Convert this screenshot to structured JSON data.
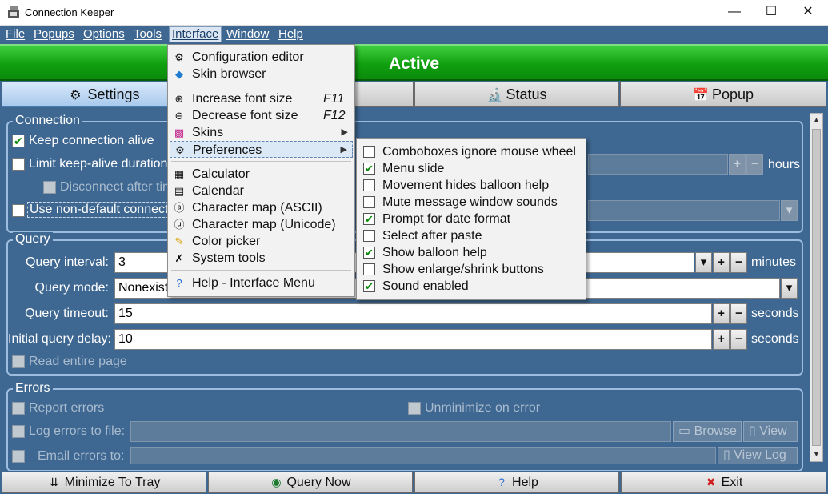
{
  "window": {
    "title": "Connection Keeper",
    "minimize": "—",
    "maximize": "☐",
    "close": "✕"
  },
  "menubar": [
    "File",
    "Popups",
    "Options",
    "Tools",
    "Interface",
    "Window",
    "Help"
  ],
  "status": {
    "text": "Active",
    "color": "#12a512"
  },
  "tabs": {
    "settings": {
      "label": "Settings",
      "icon": "gear-icon"
    },
    "status": {
      "label": "Status",
      "icon": "microscope-icon"
    },
    "popup": {
      "label": "Popup",
      "icon": "calendar-icon"
    }
  },
  "connection": {
    "label": "Connection",
    "keep_alive": {
      "label": "Keep connection alive",
      "checked": true
    },
    "limit_duration": {
      "label": "Limit keep-alive duration",
      "checked": false
    },
    "disconnect_after": {
      "label": "Disconnect after tim",
      "checked": false
    },
    "non_default": {
      "label": "Use non-default connectio",
      "checked": false
    },
    "hours_unit": "hours"
  },
  "query": {
    "label": "Query",
    "interval_label": "Query interval:",
    "interval_value": "3",
    "interval_unit": "minutes",
    "mode_label": "Query mode:",
    "mode_value": "Nonexist",
    "timeout_label": "Query timeout:",
    "timeout_value": "15",
    "timeout_unit": "seconds",
    "delay_label": "Initial query delay:",
    "delay_value": "10",
    "delay_unit": "seconds",
    "read_entire": {
      "label": "Read entire page",
      "checked": false
    }
  },
  "errors": {
    "label": "Errors",
    "report": {
      "label": "Report errors",
      "checked": false
    },
    "unminimize": {
      "label": "Unminimize on error",
      "checked": false
    },
    "log_file": {
      "label": "Log errors to file:",
      "checked": false
    },
    "browse": "Browse",
    "view": "View",
    "email": {
      "label": "Email errors to:",
      "checked": false
    },
    "view_log": "View Log"
  },
  "bottom": {
    "minimize": {
      "label": "Minimize To Tray",
      "icon": "double-chevron-down-icon"
    },
    "query_now": {
      "label": "Query Now",
      "icon": "globe-icon"
    },
    "help": {
      "label": "Help",
      "icon": "help-icon"
    },
    "exit": {
      "label": "Exit",
      "icon": "exit-icon"
    }
  },
  "interface_menu": {
    "items": [
      {
        "label": "Configuration editor",
        "icon": "settings-icon"
      },
      {
        "label": "Skin browser",
        "icon": "skin-icon"
      },
      {
        "label": "Increase font size",
        "shortcut": "F11",
        "icon": "zoom-in-icon"
      },
      {
        "label": "Decrease font size",
        "shortcut": "F12",
        "icon": "zoom-out-icon"
      },
      {
        "label": "Skins",
        "icon": "skins-icon"
      },
      {
        "label": "Preferences",
        "icon": "preferences-icon"
      },
      {
        "label": "Calculator",
        "icon": "calculator-icon"
      },
      {
        "label": "Calendar",
        "icon": "calendar-icon"
      },
      {
        "label": "Character map (ASCII)",
        "icon": "charmap-ascii-icon"
      },
      {
        "label": "Character map (Unicode)",
        "icon": "charmap-unicode-icon"
      },
      {
        "label": "Color picker",
        "icon": "color-picker-icon"
      },
      {
        "label": "System tools",
        "icon": "tools-icon"
      },
      {
        "label": "Help - Interface Menu",
        "icon": "help-icon"
      }
    ]
  },
  "preferences_submenu": {
    "items": [
      {
        "label": "Comboboxes ignore mouse wheel",
        "checked": false
      },
      {
        "label": "Menu slide",
        "checked": true
      },
      {
        "label": "Movement hides balloon help",
        "checked": false
      },
      {
        "label": "Mute message window sounds",
        "checked": false
      },
      {
        "label": "Prompt for date format",
        "checked": true
      },
      {
        "label": "Select after paste",
        "checked": false
      },
      {
        "label": "Show balloon help",
        "checked": true
      },
      {
        "label": "Show enlarge/shrink buttons",
        "checked": false
      },
      {
        "label": "Sound enabled",
        "checked": true
      }
    ]
  }
}
